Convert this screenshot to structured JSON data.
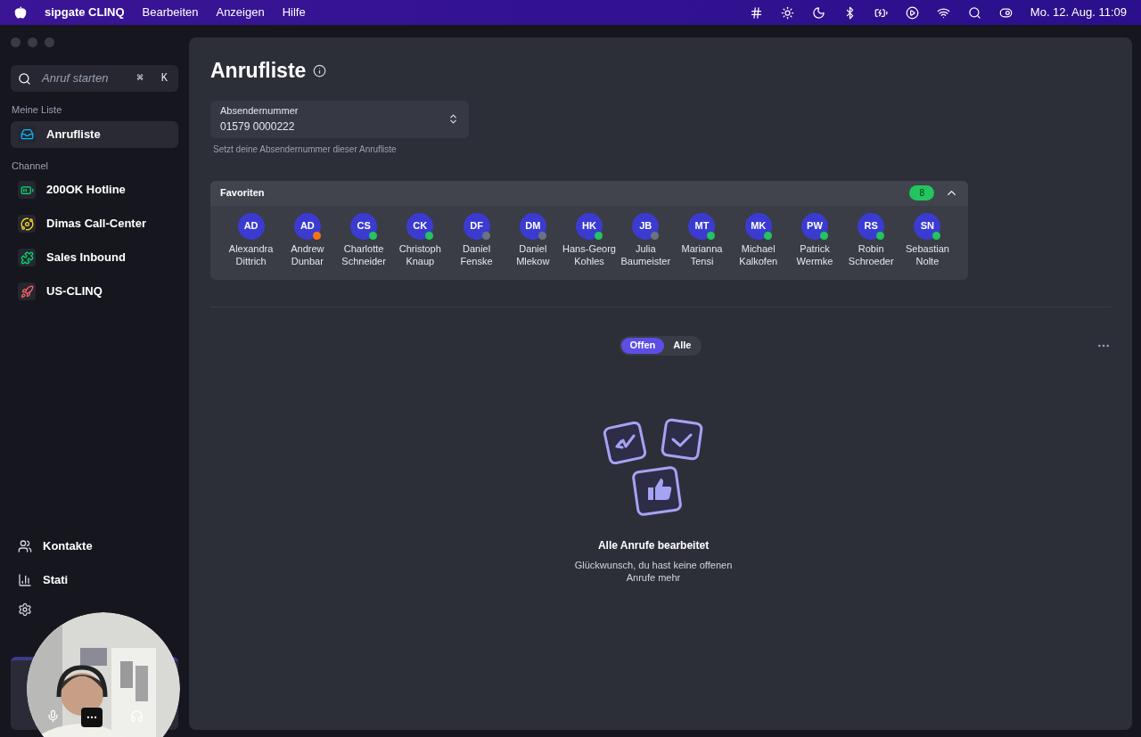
{
  "menu_bar": {
    "app_name": "sipgate CLINQ",
    "menus": [
      "Bearbeiten",
      "Anzeigen",
      "Hilfe"
    ],
    "clock": "Mo. 12. Aug. 11:09"
  },
  "sidebar": {
    "search": {
      "placeholder": "Anruf starten",
      "shortcut": [
        "⌘",
        "K"
      ]
    },
    "sections": [
      {
        "title": "Meine Liste",
        "items": [
          {
            "label": "Anrufliste",
            "kind": "inbox",
            "selected": true
          }
        ]
      },
      {
        "title": "Channel",
        "items": [
          {
            "label": "200OK Hotline",
            "kind": "battery",
            "selected": false
          },
          {
            "label": "Dimas Call-Center",
            "kind": "planet",
            "selected": false
          },
          {
            "label": "Sales Inbound",
            "kind": "puzzle",
            "selected": false
          },
          {
            "label": "US-CLINQ",
            "kind": "rocket",
            "selected": false
          }
        ]
      }
    ],
    "bottom_nav": [
      {
        "label": "Kontakte",
        "kind": "users"
      },
      {
        "label": "Stati",
        "kind": "chart"
      },
      {
        "kind": "settings"
      }
    ]
  },
  "page": {
    "title": "Anrufliste",
    "sender": {
      "label": "Absendernummer",
      "value": "01579 0000222",
      "hint": "Setzt deine Absendernummer dieser Anrufliste"
    },
    "favorites": {
      "title": "Favoriten",
      "count": "8",
      "expanded": true,
      "people": [
        {
          "initials": "AD",
          "first": "Alexandra",
          "last": "Dittrich"
        },
        {
          "initials": "AD",
          "first": "Andrew",
          "last": "Dunbar",
          "color": "#f97316"
        },
        {
          "initials": "CS",
          "first": "Charlotte",
          "last": "Schneider",
          "color": "#22c55e"
        },
        {
          "initials": "CK",
          "first": "Christoph",
          "last": "Knaup",
          "color": "#22c55e"
        },
        {
          "initials": "DF",
          "first": "Daniel",
          "last": "Fenske",
          "color": "#6b7280"
        },
        {
          "initials": "DM",
          "first": "Daniel",
          "last": "Mlekow",
          "color": "#6b7280"
        },
        {
          "initials": "HK",
          "first": "Hans-Georg",
          "last": "Kohles",
          "color": "#22c55e"
        },
        {
          "initials": "JB",
          "first": "Julia",
          "last": "Baumeister",
          "color": "#6b7280"
        },
        {
          "initials": "MT",
          "first": "Marianna",
          "last": "Tensi",
          "color": "#22c55e"
        },
        {
          "initials": "MK",
          "first": "Michael",
          "last": "Kalkofen",
          "color": "#22c55e"
        },
        {
          "initials": "PW",
          "first": "Patrick",
          "last": "Wermke",
          "color": "#22c55e"
        },
        {
          "initials": "RS",
          "first": "Robin",
          "last": "Schroeder",
          "color": "#22c55e"
        },
        {
          "initials": "SN",
          "first": "Sebastian",
          "last": "Nolte",
          "color": "#22c55e"
        }
      ]
    },
    "filter_tabs": [
      {
        "label": "Offen",
        "selected": true
      },
      {
        "label": "Alle",
        "selected": false
      }
    ],
    "empty_state": {
      "title": "Alle Anrufe bearbeitet",
      "text": "Glückwunsch, du hast keine offenen Anrufe mehr"
    }
  }
}
